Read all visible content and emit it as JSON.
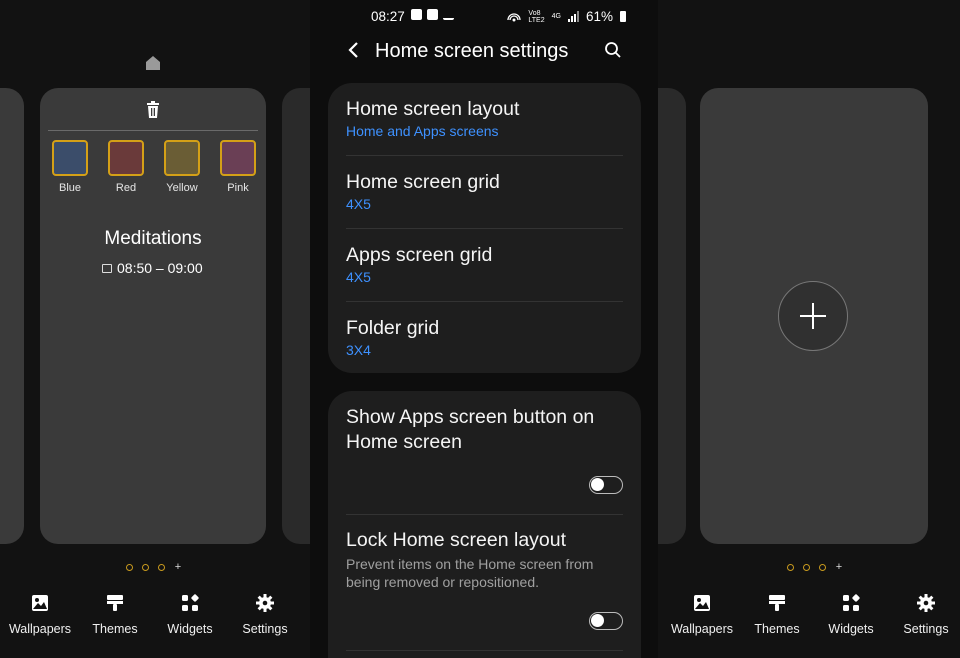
{
  "left_panel": {
    "swatches": [
      {
        "label": "Blue",
        "color": "#3b4d6a"
      },
      {
        "label": "Red",
        "color": "#6a3a3a"
      },
      {
        "label": "Yellow",
        "color": "#6a5d35"
      },
      {
        "label": "Pink",
        "color": "#6a3f55"
      }
    ],
    "event_title": "Meditations",
    "event_time": "08:50 – 09:00"
  },
  "bottom_nav": [
    {
      "label": "Wallpapers",
      "icon": "wallpaper-icon"
    },
    {
      "label": "Themes",
      "icon": "brush-icon"
    },
    {
      "label": "Widgets",
      "icon": "widgets-icon"
    },
    {
      "label": "Settings",
      "icon": "gear-icon"
    }
  ],
  "status_bar": {
    "time": "08:27",
    "network_label_top": "Vo8",
    "network_label_bottom": "LTE2",
    "network_type": "4G",
    "battery": "61%"
  },
  "header": {
    "title": "Home screen settings"
  },
  "settings_group_1": [
    {
      "title": "Home screen layout",
      "value": "Home and Apps screens"
    },
    {
      "title": "Home screen grid",
      "value": "4X5"
    },
    {
      "title": "Apps screen grid",
      "value": "4X5"
    },
    {
      "title": "Folder grid",
      "value": "3X4"
    }
  ],
  "settings_group_2": {
    "apps_button": {
      "title": "Show Apps screen button on Home screen",
      "enabled": false
    },
    "lock_layout": {
      "title": "Lock Home screen layout",
      "description": "Prevent items on the Home screen from being removed or repositioned.",
      "enabled": false
    }
  },
  "colors": {
    "accent_blue": "#3e91ff",
    "swatch_border": "#d4a017",
    "card_bg": "#3a3a3a",
    "settings_bg": "#1e1e1e"
  }
}
